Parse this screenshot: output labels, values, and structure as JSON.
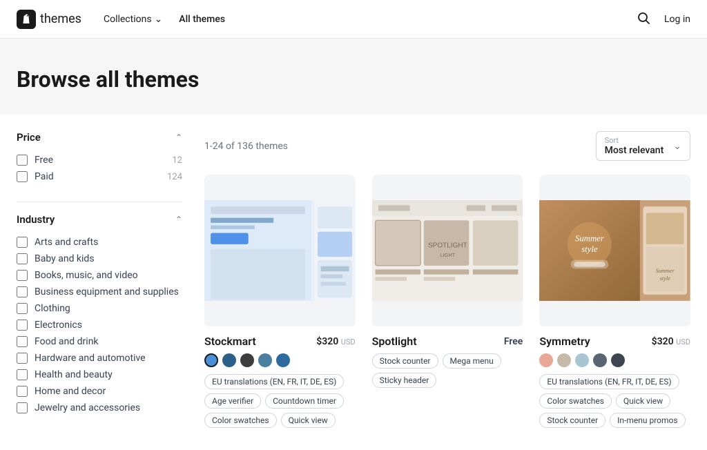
{
  "nav": {
    "logo_text": "themes",
    "links": [
      {
        "label": "Collections",
        "has_dropdown": true,
        "active": false
      },
      {
        "label": "All themes",
        "has_dropdown": false,
        "active": true
      }
    ],
    "actions": {
      "login_label": "Log in"
    }
  },
  "hero": {
    "title": "Browse all themes"
  },
  "sidebar": {
    "price_section": {
      "title": "Price",
      "expanded": true,
      "items": [
        {
          "label": "Free",
          "count": "12",
          "checked": false
        },
        {
          "label": "Paid",
          "count": "124",
          "checked": false
        }
      ]
    },
    "industry_section": {
      "title": "Industry",
      "expanded": true,
      "items": [
        {
          "label": "Arts and crafts",
          "checked": false
        },
        {
          "label": "Baby and kids",
          "checked": false
        },
        {
          "label": "Books, music, and video",
          "checked": false
        },
        {
          "label": "Business equipment and supplies",
          "checked": false
        },
        {
          "label": "Clothing",
          "checked": false
        },
        {
          "label": "Electronics",
          "checked": false
        },
        {
          "label": "Food and drink",
          "checked": false
        },
        {
          "label": "Hardware and automotive",
          "checked": false
        },
        {
          "label": "Health and beauty",
          "checked": false
        },
        {
          "label": "Home and decor",
          "checked": false
        },
        {
          "label": "Jewelry and accessories",
          "checked": false
        }
      ]
    }
  },
  "content": {
    "results_text": "1-24 of 136 themes",
    "sort": {
      "label": "Sort",
      "value": "Most relevant"
    },
    "themes": [
      {
        "name": "Stockmart",
        "price": "$320",
        "currency": "USD",
        "is_free": false,
        "colors": [
          {
            "hex": "#4a90d9",
            "selected": true
          },
          {
            "hex": "#2c5f8a",
            "selected": false
          },
          {
            "hex": "#3d3d3d",
            "selected": false
          },
          {
            "hex": "#4a7fa0",
            "selected": false
          },
          {
            "hex": "#2d6b9e",
            "selected": false
          }
        ],
        "tags": [
          "EU translations (EN, FR, IT, DE, ES)",
          "Age verifier",
          "Countdown timer",
          "Color swatches",
          "Quick view"
        ],
        "img_class": "stockmart-img"
      },
      {
        "name": "Spotlight",
        "price": "Free",
        "currency": "",
        "is_free": true,
        "colors": [],
        "tags": [
          "Stock counter",
          "Mega menu",
          "Sticky header"
        ],
        "img_class": "spotlight-img"
      },
      {
        "name": "Symmetry",
        "price": "$320",
        "currency": "USD",
        "is_free": false,
        "colors": [
          {
            "hex": "#e8a898",
            "selected": false
          },
          {
            "hex": "#c5b9a8",
            "selected": false
          },
          {
            "hex": "#a8c5d4",
            "selected": false
          },
          {
            "hex": "#5a6472",
            "selected": false
          },
          {
            "hex": "#3d4550",
            "selected": false
          }
        ],
        "tags": [
          "EU translations (EN, FR, IT, DE, ES)",
          "Color swatches",
          "Quick view",
          "Stock counter",
          "In-menu promos"
        ],
        "img_class": "symmetry-img"
      }
    ]
  }
}
